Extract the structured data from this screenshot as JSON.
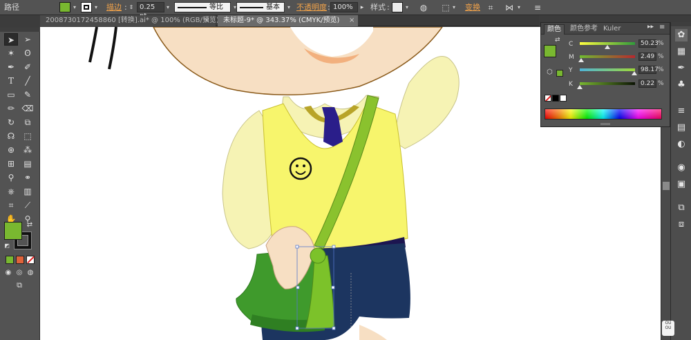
{
  "control_bar": {
    "object_type": "路径",
    "fill_color": "#79b830",
    "stroke_label": "描边",
    "stroke_weight": "0.25 pt",
    "profile_label": "等比",
    "brush_label": "基本",
    "opacity_label": "不透明度",
    "opacity_value": "100%",
    "style_label": "样式",
    "transform_label": "变换"
  },
  "tabs": [
    {
      "label": "2008730172458860 [转换].ai* @ 100% (RGB/预览)",
      "active": false,
      "close": "×"
    },
    {
      "label": "未标题-9* @ 343.37% (CMYK/预览)",
      "active": true,
      "close": "×"
    }
  ],
  "tools": {
    "selection": "selection-tool-icon",
    "direct_selection": "direct-selection-tool-icon",
    "magic_wand": "magic-wand-tool-icon",
    "lasso": "lasso-tool-icon",
    "pen": "pen-tool-icon",
    "curvature": "curvature-tool-icon",
    "type": "type-tool-icon",
    "line": "line-tool-icon",
    "rectangle": "rectangle-tool-icon",
    "paintbrush": "paintbrush-tool-icon",
    "pencil": "pencil-tool-icon",
    "eraser": "eraser-tool-icon",
    "rotate": "rotate-tool-icon",
    "scale": "scale-tool-icon",
    "warp": "warp-tool-icon",
    "free_transform": "free-transform-tool-icon",
    "shape_builder": "shape-builder-tool-icon",
    "symbol_sprayer": "symbol-sprayer-tool-icon",
    "mesh": "mesh-tool-icon",
    "gradient": "gradient-tool-icon",
    "eyedropper": "eyedropper-tool-icon",
    "blend": "blend-tool-icon",
    "column_graph": "column-graph-tool-icon",
    "artboard": "artboard-tool-icon",
    "slice": "slice-tool-icon",
    "hand": "hand-tool-icon",
    "zoom": "zoom-tool-icon",
    "fill_color": "#79b830",
    "stroke_color": "#000000"
  },
  "color_panel": {
    "tabs": [
      "颜色",
      "颜色参考",
      "Kuler"
    ],
    "fill_color": "#79b830",
    "channels": [
      {
        "label": "C",
        "value": "50.23",
        "fraction": 0.5023,
        "gradient": "linear-gradient(to right,#ffff40,#2f9a3a)"
      },
      {
        "label": "M",
        "value": "2.49",
        "fraction": 0.0249,
        "gradient": "linear-gradient(to right,#6fbc30,#b8282e)"
      },
      {
        "label": "Y",
        "value": "98.17",
        "fraction": 0.9817,
        "gradient": "linear-gradient(to right,#4fb4d8,#9ed838)"
      },
      {
        "label": "K",
        "value": "0.22",
        "fraction": 0.0022,
        "gradient": "linear-gradient(to right,#79b830,#0c1404)"
      }
    ],
    "percent": "%"
  },
  "dock_icons": [
    "color-palette-icon",
    "swatches-icon",
    "brushes-icon",
    "symbols-icon",
    "stroke-icon",
    "gradient-icon",
    "transparency-icon",
    "appearance-icon",
    "graphic-styles-icon",
    "layers-icon",
    "artboards-icon"
  ],
  "watermark": {
    "line1": "OU",
    "line2": "OU"
  }
}
